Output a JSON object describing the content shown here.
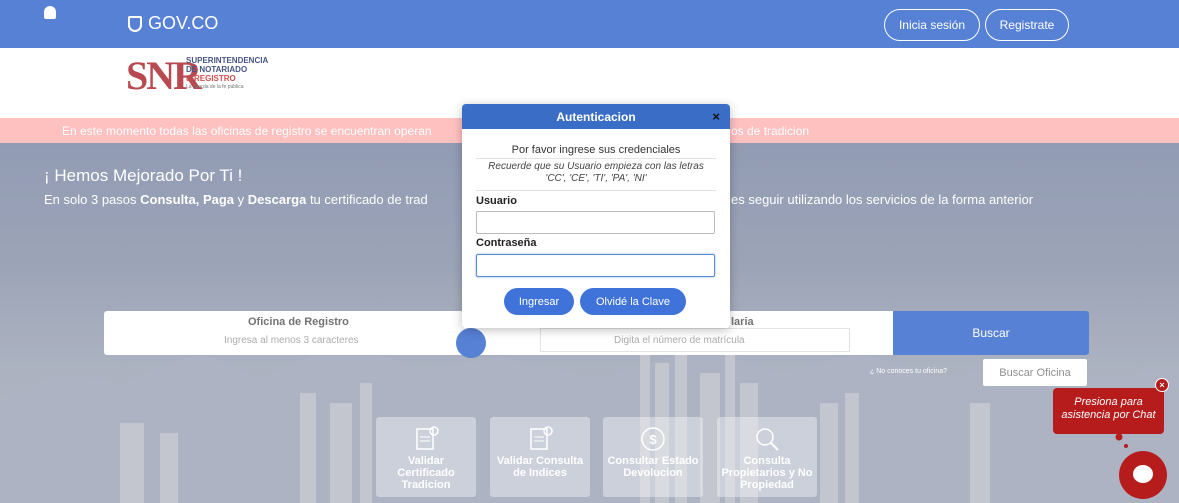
{
  "topbar": {
    "brand": "GOV.CO",
    "login_label": "Inicia sesión",
    "register_label": "Registrate"
  },
  "logo": {
    "letters": "SNR",
    "line1": "SUPERINTENDENCIA",
    "line2": "DE NOTARIADO",
    "line3": "& REGISTRO",
    "tagline": "La guarda de la fe pública"
  },
  "alert": {
    "text_left": "En este momento todas las oficinas de registro se encuentran operan",
    "text_right": "os de tradicion"
  },
  "hero": {
    "title": "¡ Hemos Mejorado Por Ti !",
    "sub_prefix": "En solo 3 pasos ",
    "sub_bold1": "Consulta, Paga",
    "sub_mid": " y ",
    "sub_bold2": "Descarga",
    "sub_suffix": " tu certificado de trad",
    "sub_right": "es seguir utilizando los servicios de la forma anterior"
  },
  "search": {
    "office_label": "Oficina de Registro",
    "office_placeholder": "Ingresa al menos 3 caracteres",
    "matricula_label": "laria",
    "matricula_placeholder": "Digita el número de matrícula",
    "search_button": "Buscar",
    "no_office_text": "¿ No conoces tu oficina?",
    "find_office_button": "Buscar Oficina"
  },
  "tiles": [
    {
      "label": "Validar Certificado Tradicion",
      "icon": "certificate-icon"
    },
    {
      "label": "Validar Consulta de Indices",
      "icon": "document-check-icon"
    },
    {
      "label": "Consultar Estado Devolucion",
      "icon": "money-icon"
    },
    {
      "label": "Consulta Propietarios y No Propiedad",
      "icon": "magnifier-icon"
    }
  ],
  "modal": {
    "title": "Autenticacion",
    "close": "×",
    "prompt": "Por favor ingrese sus credenciales",
    "note": "Recuerde que su Usuario empieza con las letras 'CC', 'CE', 'TI', 'PA', 'NI'",
    "user_label": "Usuario",
    "user_value": "",
    "password_label": "Contraseña",
    "password_value": "",
    "login_button": "Ingresar",
    "forgot_button": "Olvidé la Clave"
  },
  "chat": {
    "prompt": "Presiona para asistencia por Chat",
    "close": "×"
  },
  "colors": {
    "gov_blue": "#3366cc",
    "modal_header": "#3a6ec6",
    "button_blue": "#3f73d9",
    "chat_red": "#b71c1c",
    "alert_pink": "#ffb3b3"
  }
}
